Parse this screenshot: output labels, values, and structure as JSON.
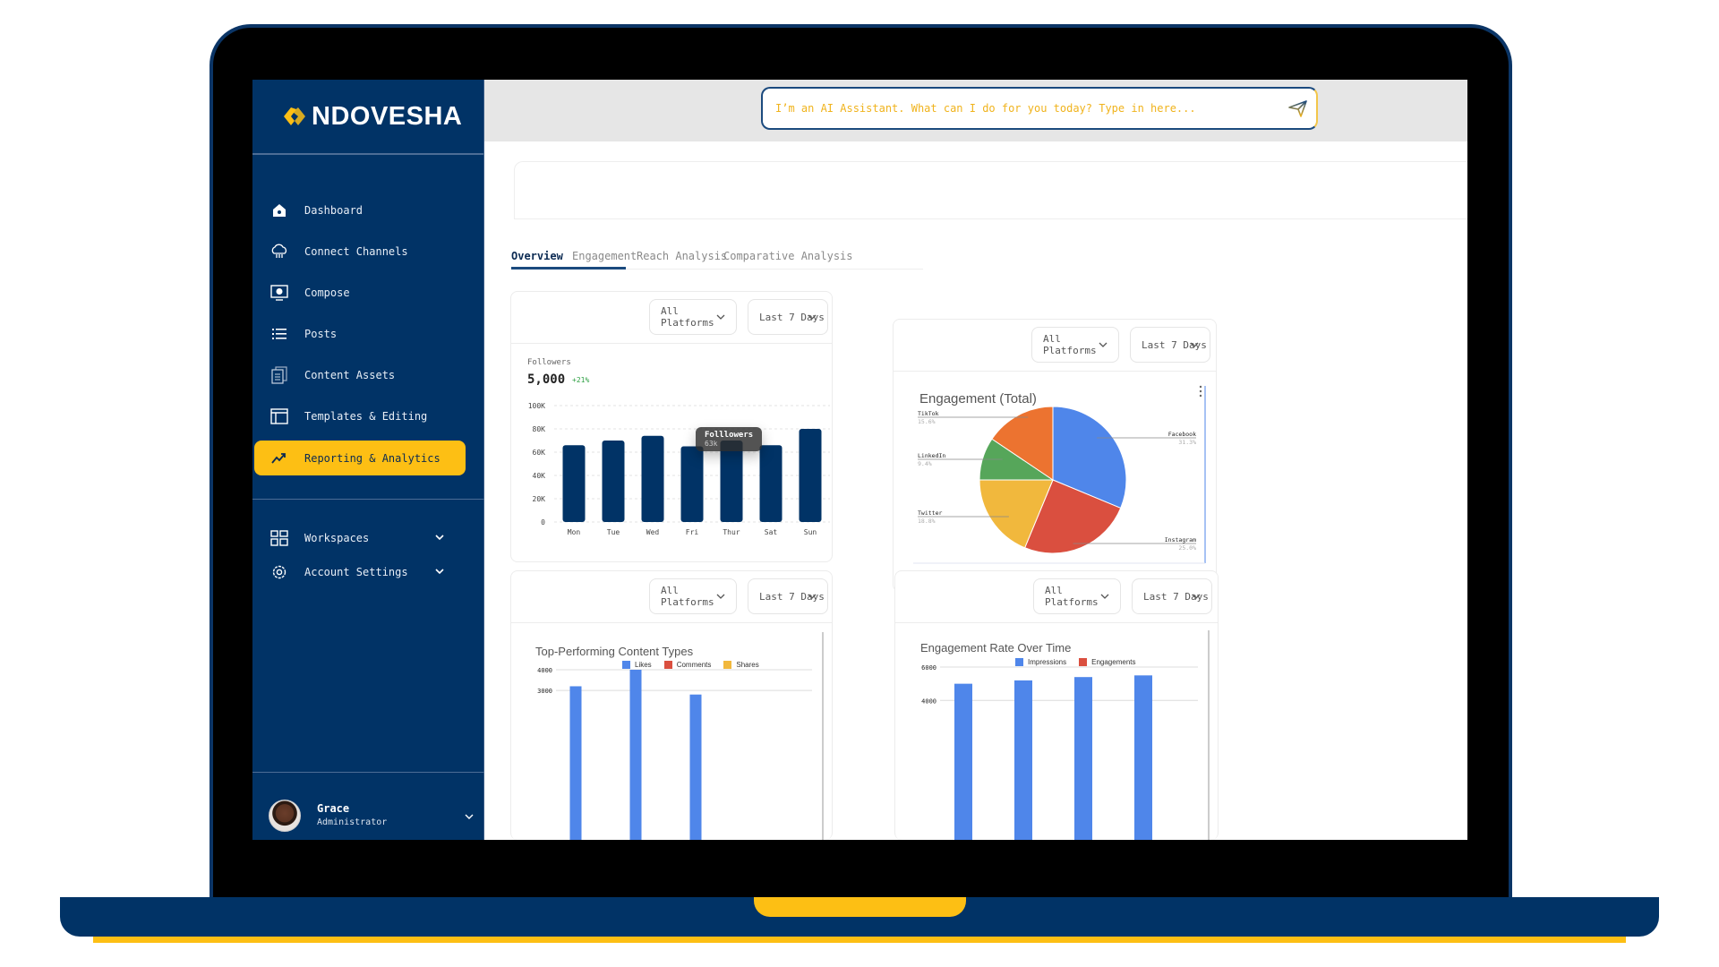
{
  "app": {
    "brand": "NDOVESHA",
    "colors": {
      "navy": "#013366",
      "accent": "#fdbf14"
    }
  },
  "sidebar": {
    "items": [
      {
        "label": "Dashboard",
        "icon": "home-icon"
      },
      {
        "label": "Connect Channels",
        "icon": "cloud-icon"
      },
      {
        "label": "Compose",
        "icon": "monitor-icon"
      },
      {
        "label": "Posts",
        "icon": "list-icon"
      },
      {
        "label": "Content Assets",
        "icon": "documents-icon"
      },
      {
        "label": "Templates & Editing",
        "icon": "layout-icon"
      },
      {
        "label": "Reporting & Analytics",
        "icon": "trend-icon",
        "active": true
      }
    ],
    "groups": [
      {
        "label": "Workspaces",
        "icon": "grid-icon"
      },
      {
        "label": "Account Settings",
        "icon": "gear-icon"
      }
    ],
    "user": {
      "name": "Grace",
      "role": "Administrator"
    }
  },
  "header": {
    "ai_placeholder": "I’m an AI Assistant. What can I do for you today? Type in here..."
  },
  "tabs": [
    {
      "label": "Overview",
      "active": true
    },
    {
      "label": "Engagement"
    },
    {
      "label": "Reach Analysis"
    },
    {
      "label": "Comparative Analysis"
    }
  ],
  "filters": {
    "platform": "All Platforms",
    "period": "Last 7 Days"
  },
  "followers": {
    "label": "Followers",
    "value": "5,000",
    "delta": "+21%"
  },
  "tooltip": {
    "title": "Folllowers",
    "value": "63k"
  },
  "chart_data": [
    {
      "type": "bar",
      "title": "Followers",
      "categories": [
        "Mon",
        "Tue",
        "Wed",
        "Fri",
        "Thur",
        "Sat",
        "Sun"
      ],
      "values": [
        66000,
        70000,
        74000,
        65000,
        70000,
        66000,
        80000
      ],
      "yticks": [
        "0",
        "20K",
        "40K",
        "60K",
        "80K",
        "100K"
      ],
      "ylim": [
        0,
        100000
      ],
      "color": "#013366",
      "grid": true
    },
    {
      "type": "pie",
      "title": "Engagement (Total)",
      "slices": [
        {
          "label": "Facebook",
          "value": 31.3,
          "pct": "31.3%",
          "color": "#4f86ea"
        },
        {
          "label": "Instagram",
          "value": 25.0,
          "pct": "25.0%",
          "color": "#da4f3f"
        },
        {
          "label": "Twitter",
          "value": 18.8,
          "pct": "18.8%",
          "color": "#f1b83d"
        },
        {
          "label": "LinkedIn",
          "value": 9.4,
          "pct": "9.4%",
          "color": "#56a65a"
        },
        {
          "label": "TikTok",
          "value": 15.6,
          "pct": "15.6%",
          "color": "#ec7330"
        }
      ]
    },
    {
      "type": "bar",
      "title": "Top-Performing Content Types",
      "legend": [
        {
          "name": "Likes",
          "color": "#4f86ea"
        },
        {
          "name": "Comments",
          "color": "#da4f3f"
        },
        {
          "name": "Shares",
          "color": "#f1b83d"
        }
      ],
      "yticks": [
        "3000",
        "4000"
      ],
      "series": [
        {
          "name": "Likes",
          "values": [
            3200,
            4000,
            2800
          ]
        }
      ],
      "ylim_visible": [
        2700,
        4000
      ]
    },
    {
      "type": "bar",
      "title": "Engagement Rate Over Time",
      "legend": [
        {
          "name": "Impressions",
          "color": "#4f86ea"
        },
        {
          "name": "Engagements",
          "color": "#da4f3f"
        }
      ],
      "yticks": [
        "4000",
        "6000"
      ],
      "series": [
        {
          "name": "Impressions",
          "values": [
            5000,
            5200,
            5400,
            5500
          ]
        }
      ],
      "ylim_visible": [
        3800,
        6000
      ]
    }
  ]
}
